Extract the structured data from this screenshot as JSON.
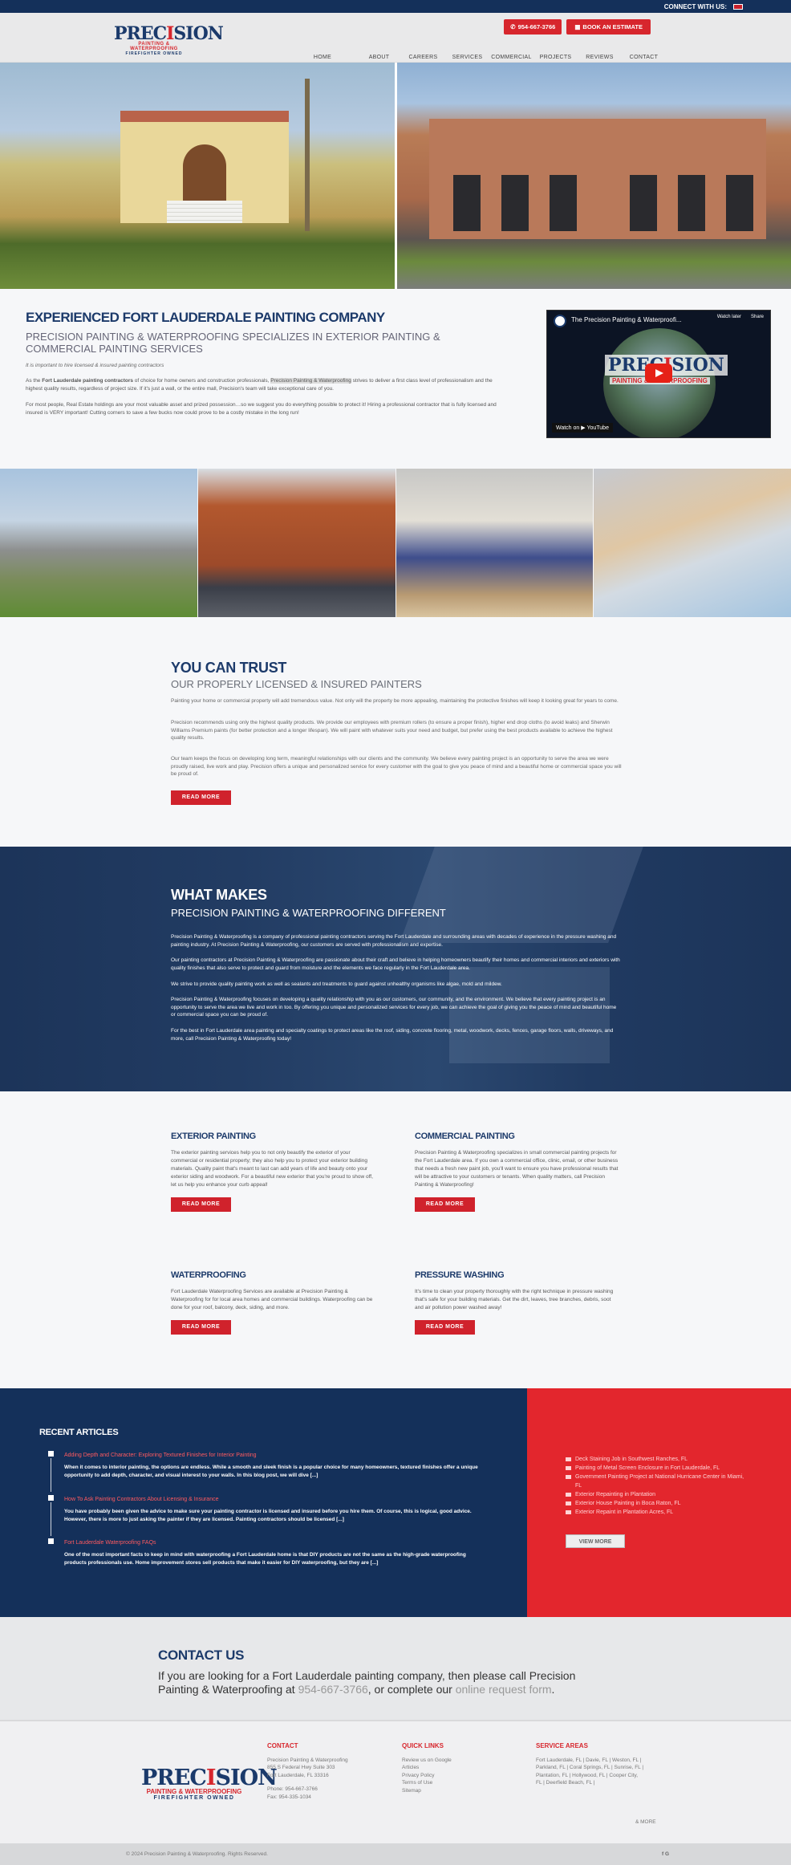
{
  "topbar": {
    "connect": "CONNECT WITH US:"
  },
  "logo": {
    "pre": "PREC",
    "mid": "I",
    "post": "SION",
    "line2": "PAINTING & WATERPROOFING",
    "line3": "FIREFIGHTER OWNED"
  },
  "header": {
    "phone": "954-667-3766",
    "estimate": "BOOK AN ESTIMATE",
    "nav": [
      "HOME",
      "ABOUT",
      "CAREERS",
      "SERVICES",
      "COMMERCIAL",
      "PROJECTS",
      "REVIEWS",
      "CONTACT"
    ]
  },
  "intro": {
    "title": "EXPERIENCED FORT LAUDERDALE PAINTING COMPANY",
    "subtitle": "PRECISION PAINTING & WATERPROOFING SPECIALIZES IN EXTERIOR PAINTING & COMMERCIAL PAINTING SERVICES",
    "note": "It is important to hire licensed & insured painting contractors",
    "p1_a": "As the ",
    "p1_b": "Fort Lauderdale painting contractors",
    "p1_c": " of choice for home owners and construction professionals, ",
    "p1_d": "Precision Painting & Waterproofing",
    "p1_e": " strives to deliver a first class level of professionalism and the highest quality results, regardless of project size. If it's just a wall, or the entire mall, Precision's team will take exceptional care of you.",
    "p2": "For most people, Real Estate holdings are your most valuable asset and prized possession…so we suggest you do everything possible to protect it! Hiring a professional contractor that is fully licensed and insured is VERY important! Cutting corners to save a few bucks now could prove to be a costly mistake in the long run!"
  },
  "video": {
    "title": "The Precision Painting & Waterproofi...",
    "watch_later": "Watch later",
    "share": "Share",
    "logo_pre": "PREC",
    "logo_mid": "I",
    "logo_post": "SION",
    "logo_sub": "PAINTING & WATERPROOFING",
    "watch_on": "Watch on ▶ YouTube"
  },
  "trust": {
    "title": "YOU CAN TRUST",
    "subtitle": "OUR PROPERLY LICENSED & INSURED PAINTERS",
    "p1": "Painting your home or commercial property will add tremendous value. Not only will the property be more appealing, maintaining the protective finishes will keep it looking great for years to come.",
    "p2": "Precision recommends using only the highest quality products. We provide our employees with premium rollers (to ensure a proper finish), higher end drop cloths (to avoid leaks) and Sherwin Williams Premium paints (for better protection and a longer lifespan). We will paint with whatever suits your need and budget, but prefer using the best products available to achieve the highest quality results.",
    "p3": "Our team keeps the focus on developing long term, meaningful relationships with our clients and the community. We believe every painting project is an opportunity to serve the area we were proudly raised, live work and play. Precision offers a unique and personalized service for every customer with the goal to give you peace of mind and a beautiful home or commercial space you will be proud of.",
    "button": "READ MORE"
  },
  "different": {
    "title": "WHAT MAKES",
    "subtitle": "PRECISION PAINTING & WATERPROOFING DIFFERENT",
    "p1": "Precision Painting & Waterproofing is a company of professional painting contractors serving the Fort Lauderdale and surrounding areas with decades of experience in the pressure washing and painting industry. At Precision Painting & Waterproofing, our customers are served with professionalism and expertise.",
    "p2": "Our painting contractors at Precision Painting & Waterproofing are passionate about their craft and believe in helping homeowners beautify their homes and commercial interiors and exteriors with quality finishes that also serve to protect and guard from moisture and the elements we face regularly in the Fort Lauderdale area.",
    "p3": "We strive to provide quality painting work as well as sealants and treatments to guard against unhealthy organisms like algae, mold and mildew.",
    "p4": "Precision Painting & Waterproofing focuses on developing a quality relationship with you as our customers, our community, and the environment. We believe that every painting project is an opportunity to serve the area we live and work in too. By offering you unique and personalized services for every job, we can achieve the goal of giving you the peace of mind and beautiful home or commercial space you can be proud of.",
    "p5": "For the best in Fort Lauderdale area painting and specialty coatings to protect areas like the roof, siding, concrete flooring, metal, woodwork, decks, fences, garage floors, walls, driveways, and more, call Precision Painting & Waterproofing today!"
  },
  "services": [
    {
      "title": "EXTERIOR PAINTING",
      "text": "The exterior painting services help you to not only beautify the exterior of your commercial or residential property; they also help you to protect your exterior building materials. Quality paint that's meant to last can add years of life and beauty onto your exterior siding and woodwork. For a beautiful new exterior that you're proud to show off, let us help you enhance your curb appeal!",
      "button": "READ MORE"
    },
    {
      "title": "COMMERCIAL PAINTING",
      "text": "Precision Painting & Waterproofing specializes in small commercial painting projects for the Fort Lauderdale area. If you own a commercial office, clinic, email, or other business that needs a fresh new paint job, you'll want to ensure you have professional results that will be attractive to your customers or tenants. When quality matters, call Precision Painting & Waterproofing!",
      "button": "READ MORE"
    },
    {
      "title": "WATERPROOFING",
      "text": "Fort Lauderdale Waterproofing Services are available at Precision Painting & Waterproofing for for local area homes and commercial buildings. Waterproofing can be done for your roof, balcony, deck, siding, and more.",
      "button": "READ MORE"
    },
    {
      "title": "PRESSURE WASHING",
      "text": "It's time to clean your property thoroughly with the right technique in pressure washing that's safe for your building materials. Get the dirt, leaves, tree branches, debris, soot and air pollution power washed away!",
      "button": "READ MORE"
    }
  ],
  "recent": {
    "title": "RECENT ARTICLES",
    "articles": [
      {
        "title": "Adding Depth and Character: Exploring Textured Finishes for Interior Painting",
        "excerpt": "When it comes to interior painting, the options are endless. While a smooth and sleek finish is a popular choice for many homeowners, textured finishes offer a unique opportunity to add depth, character, and visual interest to your walls. In this blog post, we will dive [...]"
      },
      {
        "title": "How To Ask Painting Contractors About Licensing & Insurance",
        "excerpt": "You have probably been given the advice to make sure your painting contractor is licensed and insured before you hire them. Of course, this is logical, good advice. However, there is more to just asking the painter if they are licensed. Painting contractors should be licensed [...]"
      },
      {
        "title": "Fort Lauderdale Waterproofing FAQs",
        "excerpt": "One of the most important facts to keep in mind with waterproofing a Fort Lauderdale home is that DIY products are not the same as the high-grade waterproofing products professionals use. Home improvement stores sell products that make it easier for DIY waterproofing, but they are [...]"
      }
    ],
    "links": [
      "Deck Staining Job in Southwest Ranches, FL",
      "Painting of Metal Screen Enclosure in Fort Lauderdale, FL",
      "Government Painting Project at National Hurricane Center in Miami, FL",
      "Exterior Repainting in Plantation",
      "Exterior House Painting in Boca Raton, FL",
      "Exterior Repaint in Plantation Acres, FL"
    ],
    "view_more": "VIEW MORE"
  },
  "contact": {
    "title": "CONTACT US",
    "text_a": "If you are looking for a Fort Lauderdale painting company, then please call Precision Painting & Waterproofing at ",
    "phone": "954-667-3766",
    "text_b": ", or complete our ",
    "form": "online request form",
    "text_c": "."
  },
  "footer": {
    "contact_title": "CONTACT",
    "company": "Precision Painting & Waterproofing",
    "address1": "855 S Federal Hwy Suite 303",
    "address2": "Fort Lauderdale, FL 33316",
    "phone": "Phone: 954-667-3766",
    "fax": "Fax: 954-335-1034",
    "quick_title": "QUICK LINKS",
    "quick": [
      "Review us on Google",
      "Articles",
      "Privacy Policy",
      "Terms of Use",
      "Sitemap"
    ],
    "areas_title": "SERVICE AREAS",
    "areas": [
      "Fort Lauderdale, FL | Davie, FL | Weston, FL |",
      "Parkland, FL | Coral Springs, FL | Sunrise, FL |",
      "Plantation, FL | Hollywood, FL | Cooper City,",
      "FL | Deerfield Beach, FL |"
    ],
    "more": "& MORE",
    "copyright": "© 2024 Precision Painting & Waterproofing. Rights Reserved.",
    "social": "f G"
  }
}
